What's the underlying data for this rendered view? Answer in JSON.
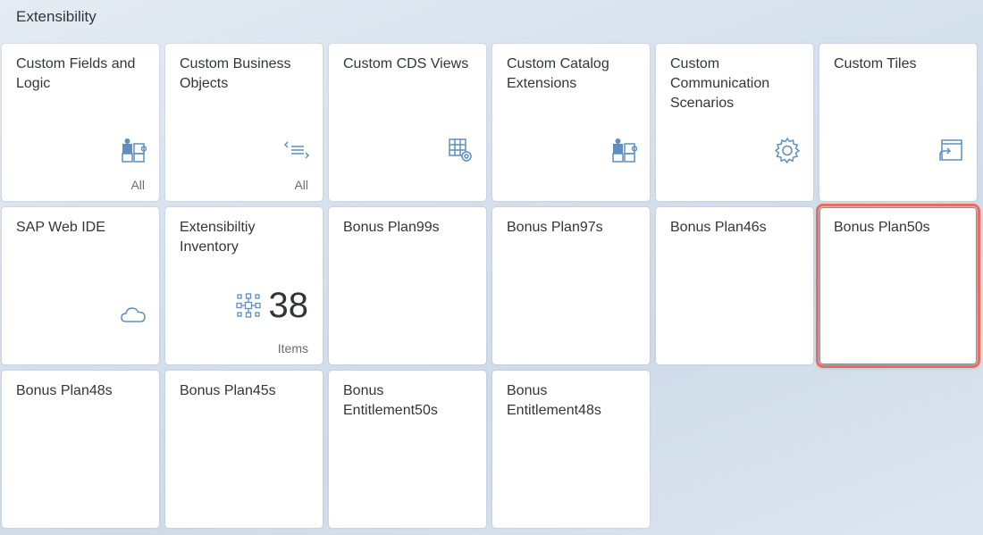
{
  "group": {
    "title": "Extensibility"
  },
  "tiles": [
    {
      "title": "Custom Fields and\nLogic",
      "footer": "All",
      "icon": "puzzle-piece-icon"
    },
    {
      "title": "Custom Business\nObjects",
      "footer": "All",
      "icon": "list-brackets-icon"
    },
    {
      "title": "Custom CDS Views",
      "footer": "",
      "icon": "table-gear-icon"
    },
    {
      "title": "Custom Catalog\nExtensions",
      "footer": "",
      "icon": "puzzle-piece-icon"
    },
    {
      "title": "Custom\nCommunication\nScenarios",
      "footer": "",
      "icon": "gear-icon"
    },
    {
      "title": "Custom Tiles",
      "footer": "",
      "icon": "tile-launch-icon"
    },
    {
      "title": "SAP Web IDE",
      "footer": "",
      "icon": "cloud-icon"
    },
    {
      "title": "Extensibiltiy\nInventory",
      "footer": "Items",
      "icon": "network-icon",
      "kpi": "38"
    },
    {
      "title": "Bonus Plan99s"
    },
    {
      "title": "Bonus Plan97s"
    },
    {
      "title": "Bonus Plan46s"
    },
    {
      "title": "Bonus Plan50s",
      "selected": true
    },
    {
      "title": "Bonus Plan48s"
    },
    {
      "title": "Bonus Plan45s"
    },
    {
      "title": "Bonus\nEntitlement50s"
    },
    {
      "title": "Bonus\nEntitlement48s"
    }
  ],
  "colors": {
    "icon": "#5f8fc0",
    "selection": "#ec6b5b"
  }
}
